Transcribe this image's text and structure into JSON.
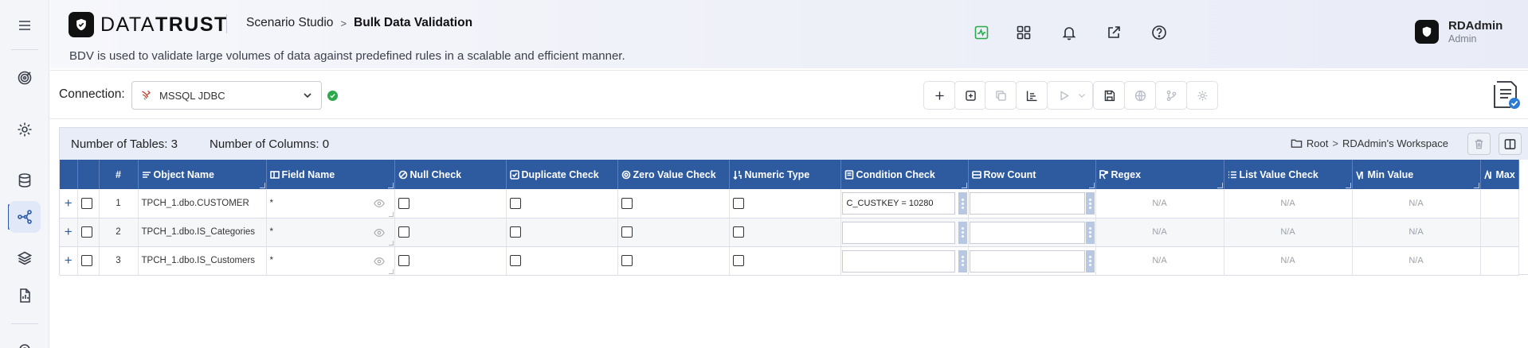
{
  "app": {
    "logo_main": "DATA",
    "logo_bold": "TRUST",
    "breadcrumb": [
      "Scenario Studio",
      "Bulk Data Validation"
    ],
    "breadcrumb_sep": ">",
    "description": "BDV is used to validate large volumes of data against predefined rules in a scalable and efficient manner."
  },
  "user": {
    "name": "RDAdmin",
    "role": "Admin"
  },
  "rail": {
    "items": [
      "menu-icon",
      "target-icon",
      "settings-icon",
      "database-icon",
      "flow-icon",
      "layers-icon",
      "report-icon"
    ],
    "active": "flow-icon"
  },
  "header_icons": [
    "activity-icon",
    "apps-grid-icon",
    "bell-icon",
    "external-link-icon",
    "help-icon"
  ],
  "toolbar": {
    "connection_label": "Connection:",
    "connection_value": "MSSQL JDBC",
    "connection_status": "connected",
    "buttons": [
      "add-icon",
      "add-box-icon",
      "copy-icon",
      "chart-icon",
      "play-icon",
      "chevron-down-icon",
      "save-icon",
      "globe-icon",
      "branch-icon",
      "gear-icon",
      "report-check-icon"
    ]
  },
  "grid": {
    "tables_label": "Number of Tables: 3",
    "columns_label": "Number of Columns: 0",
    "path_root": "Root",
    "path_sep": ">",
    "path_workspace": "RDAdmin's Workspace",
    "columns": [
      "#",
      "Object Name",
      "Field Name",
      "Null Check",
      "Duplicate Check",
      "Zero Value Check",
      "Numeric Type",
      "Condition Check",
      "Row Count",
      "Regex",
      "List Value Check",
      "Min Value",
      "Max"
    ],
    "rows": [
      {
        "num": "1",
        "object": "TPCH_1.dbo.CUSTOMER",
        "field": "*",
        "condition": "C_CUSTKEY = 10280",
        "row_count": "",
        "regex": "N/A",
        "list_value": "N/A",
        "min_value": "N/A"
      },
      {
        "num": "2",
        "object": "TPCH_1.dbo.IS_Categories",
        "field": "*",
        "condition": "",
        "row_count": "",
        "regex": "N/A",
        "list_value": "N/A",
        "min_value": "N/A"
      },
      {
        "num": "3",
        "object": "TPCH_1.dbo.IS_Customers",
        "field": "*",
        "condition": "",
        "row_count": "",
        "regex": "N/A",
        "list_value": "N/A",
        "min_value": "N/A"
      }
    ]
  },
  "colors": {
    "accent": "#2e5aa0",
    "success": "#2aa84a",
    "header_bg": "#e8edf8"
  }
}
